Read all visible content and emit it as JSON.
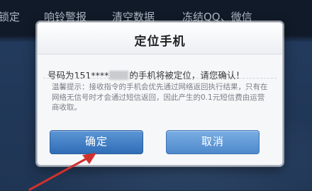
{
  "topnav": {
    "items": [
      "锁定",
      "响铃警报",
      "清空数据",
      "冻结QQ、微信"
    ]
  },
  "dialog": {
    "title": "定位手机",
    "message_prefix": "号码为151****",
    "message_suffix": "的手机将被定位，请您确认！",
    "tip": "温馨提示：接收指令的手机会优先通过网络返回执行结果，只有在网络无信号时才会通过短信返回，因此产生的0.1元短信费由运营商收取。",
    "confirm_label": "确定",
    "cancel_label": "取消"
  },
  "colors": {
    "confirm_button": "#2f6db6",
    "cancel_button": "#4f89cc",
    "annotation_arrow": "#d0312d"
  }
}
